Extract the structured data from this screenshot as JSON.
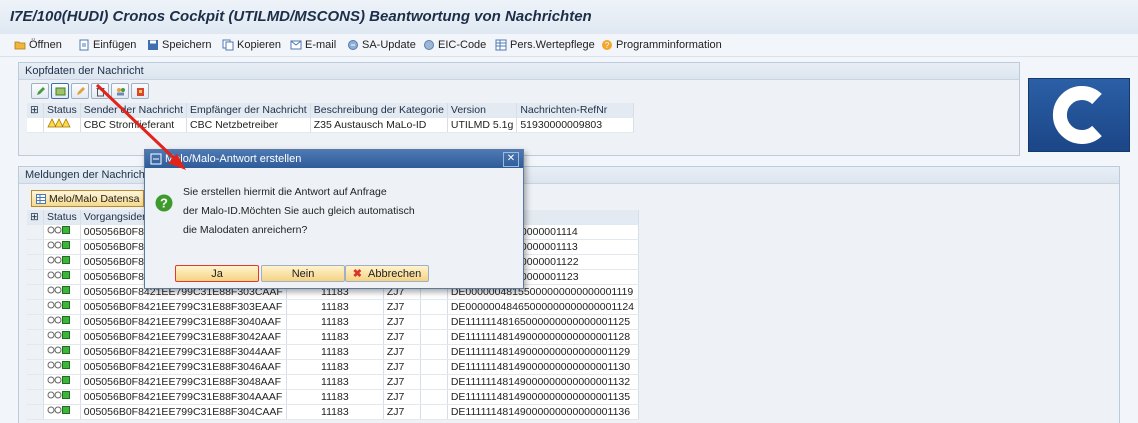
{
  "window": {
    "title": "I7E/100(HUDI) Cronos Cockpit (UTILMD/MSCONS)  Beantwortung von Nachrichten"
  },
  "toolbar": {
    "items": [
      {
        "label": "Öffnen",
        "icon": "folder-open-icon"
      },
      {
        "label": "Einfügen",
        "icon": "insert-icon"
      },
      {
        "label": "Speichern",
        "icon": "save-icon"
      },
      {
        "label": "Kopieren",
        "icon": "copy-icon"
      },
      {
        "label": "E-mail",
        "icon": "email-icon"
      },
      {
        "label": "SA-Update",
        "icon": "sa-update-icon"
      },
      {
        "label": "EIC-Code",
        "icon": "eic-code-icon"
      },
      {
        "label": "Pers.Wertepflege",
        "icon": "table-icon"
      },
      {
        "label": "Programminformation",
        "icon": "info-icon"
      }
    ]
  },
  "header_panel": {
    "title": "Kopfdaten der Nachricht",
    "buttons": [
      "edit-icon",
      "display-icon",
      "pencil-icon",
      "delete-icon",
      "people-icon",
      "bin-icon"
    ],
    "columns": [
      "Status",
      "Sender der Nachricht",
      "Empfänger der Nachricht",
      "Beschreibung der Kategorie",
      "Version",
      "Nachrichten-RefNr"
    ],
    "row": {
      "sender": "CBC Stromlieferant",
      "receiver": "CBC Netzbetreiber",
      "category": "Z35 Austausch MaLo-ID",
      "version": "UTILMD 5.1g",
      "refnr": "51930000009803"
    }
  },
  "messages_panel": {
    "title": "Meldungen der Nachricht",
    "button_label": "Melo/Malo Datensa",
    "columns": [
      "Status",
      "Vorgangsidenti"
    ],
    "rows": [
      {
        "id": "005056B0F842",
        "c1": "",
        "c2": "",
        "c3": "",
        "tail": "0000000000000000001114"
      },
      {
        "id": "005056B0F842",
        "c1": "",
        "c2": "",
        "c3": "",
        "tail": "0000000000000000001113"
      },
      {
        "id": "005056B0F842",
        "c1": "",
        "c2": "",
        "c3": "",
        "tail": "0000000000000000001122"
      },
      {
        "id": "005056B0F842",
        "c1": "",
        "c2": "",
        "c3": "",
        "tail": "0000000000000000001123"
      },
      {
        "id": "005056B0F8421EE799C31E88F303CAAF",
        "c1": "11183",
        "c2": "ZJ7",
        "c3": "",
        "tail": "DE00000048155000000000000001119"
      },
      {
        "id": "005056B0F8421EE799C31E88F303EAAF",
        "c1": "11183",
        "c2": "ZJ7",
        "c3": "",
        "tail": "DE00000048465000000000000001124"
      },
      {
        "id": "005056B0F8421EE799C31E88F3040AAF",
        "c1": "11183",
        "c2": "ZJ7",
        "c3": "",
        "tail": "DE11111148165000000000000001125"
      },
      {
        "id": "005056B0F8421EE799C31E88F3042AAF",
        "c1": "11183",
        "c2": "ZJ7",
        "c3": "",
        "tail": "DE11111148149000000000000001128"
      },
      {
        "id": "005056B0F8421EE799C31E88F3044AAF",
        "c1": "11183",
        "c2": "ZJ7",
        "c3": "",
        "tail": "DE11111148149000000000000001129"
      },
      {
        "id": "005056B0F8421EE799C31E88F3046AAF",
        "c1": "11183",
        "c2": "ZJ7",
        "c3": "",
        "tail": "DE11111148149000000000000001130"
      },
      {
        "id": "005056B0F8421EE799C31E88F3048AAF",
        "c1": "11183",
        "c2": "ZJ7",
        "c3": "",
        "tail": "DE11111148149000000000000001132"
      },
      {
        "id": "005056B0F8421EE799C31E88F304AAAF",
        "c1": "11183",
        "c2": "ZJ7",
        "c3": "",
        "tail": "DE11111148149000000000000001135"
      },
      {
        "id": "005056B0F8421EE799C31E88F304CAAF",
        "c1": "11183",
        "c2": "ZJ7",
        "c3": "",
        "tail": "DE11111148149000000000000001136"
      }
    ]
  },
  "dialog": {
    "title": "Melo/Malo-Antwort erstellen",
    "message_lines": [
      "Sie erstellen hiermit die Antwort auf Anfrage",
      "der Malo-ID.Möchten Sie auch gleich automatisch",
      "die Malodaten anreichern?"
    ],
    "buttons": {
      "yes": "Ja",
      "no": "Nein",
      "cancel": "Abbrechen"
    }
  },
  "logo": {
    "letter": "C"
  },
  "colors": {
    "dialog_header": "#2e5c99",
    "annotation_arrow": "#e2231a",
    "button_highlight": "#f6d383"
  }
}
